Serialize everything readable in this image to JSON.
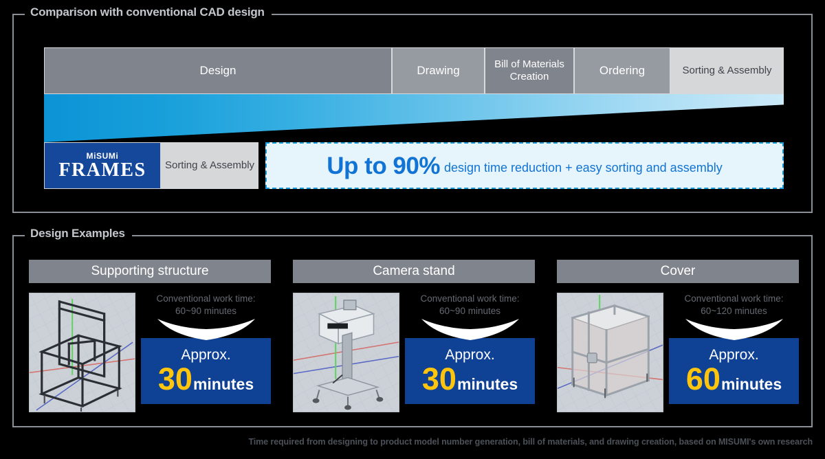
{
  "sections": {
    "comparison": {
      "title": "Comparison with conventional CAD design",
      "conventional_flow": [
        {
          "label": "Design"
        },
        {
          "label": "Drawing"
        },
        {
          "label": "Bill of Materials Creation"
        },
        {
          "label": "Ordering"
        },
        {
          "label": "Sorting & Assembly"
        }
      ],
      "frames_flow": {
        "logo_top": "MiSUMi",
        "logo_main": "FRAMES",
        "sorting_label": "Sorting & Assembly"
      },
      "result": {
        "headline": "Up to 90%",
        "description": "design time reduction + easy sorting and assembly"
      }
    },
    "examples": {
      "title": "Design Examples",
      "cards": [
        {
          "title": "Supporting structure",
          "thumbnail": "cad-supporting-structure",
          "conventional_label": "Conventional work time:",
          "conventional_value": "60~90 minutes",
          "approx_label": "Approx.",
          "approx_number": "30",
          "approx_unit": "minutes"
        },
        {
          "title": "Camera stand",
          "thumbnail": "cad-camera-stand",
          "conventional_label": "Conventional work time:",
          "conventional_value": "60~90 minutes",
          "approx_label": "Approx.",
          "approx_number": "30",
          "approx_unit": "minutes"
        },
        {
          "title": "Cover",
          "thumbnail": "cad-cover",
          "conventional_label": "Conventional work time:",
          "conventional_value": "60~120 minutes",
          "approx_label": "Approx.",
          "approx_number": "60",
          "approx_unit": "minutes"
        }
      ]
    }
  },
  "footnote": "Time required from designing to product model number generation, bill of materials, and drawing creation, based on MISUMI's own research",
  "colors": {
    "frame_border": "#8b9097",
    "segment_dark": "#80858d",
    "segment_light": "#969ba2",
    "segment_pale": "#d6d7d9",
    "misumi_blue": "#15479b",
    "accent_blue": "#1173d4",
    "result_bg": "#e6f4fc",
    "approx_bg": "#0f4194",
    "approx_number": "#ffc50d",
    "wedge_start": "#0b93d6",
    "wedge_end": "#cceaf8"
  }
}
